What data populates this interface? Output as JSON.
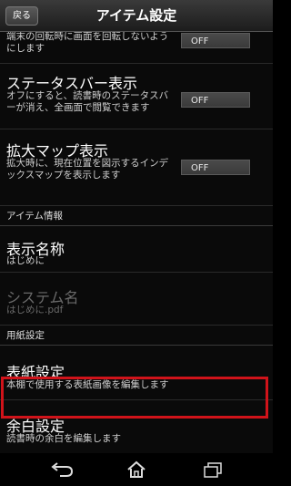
{
  "header": {
    "back_label": "戻る",
    "title": "アイテム設定"
  },
  "items": [
    {
      "desc": "端末の回転時に画面を回転しないようにします",
      "toggle": "OFF"
    },
    {
      "title": "ステータスバー表示",
      "desc": "オフにすると、読書時のステータスバーが消え、全画面で閲覧できます",
      "toggle": "OFF"
    },
    {
      "title": "拡大マップ表示",
      "desc": "拡大時に、現在位置を図示するインデックスマップを表示します",
      "toggle": "OFF"
    }
  ],
  "sections": {
    "item_info": "アイテム情報",
    "paper": "用紙設定"
  },
  "display_name": {
    "title": "表示名称",
    "value": "はじめに"
  },
  "system_name": {
    "title": "システム名",
    "value": "はじめに.pdf"
  },
  "cover": {
    "title": "表紙設定",
    "desc": "本棚で使用する表紙画像を編集します"
  },
  "margin": {
    "title": "余白設定",
    "desc": "読書時の余白を編集します"
  },
  "colors": {
    "highlight": "#d0131a"
  },
  "nav_icons": [
    "back-icon",
    "home-icon",
    "recent-apps-icon"
  ]
}
